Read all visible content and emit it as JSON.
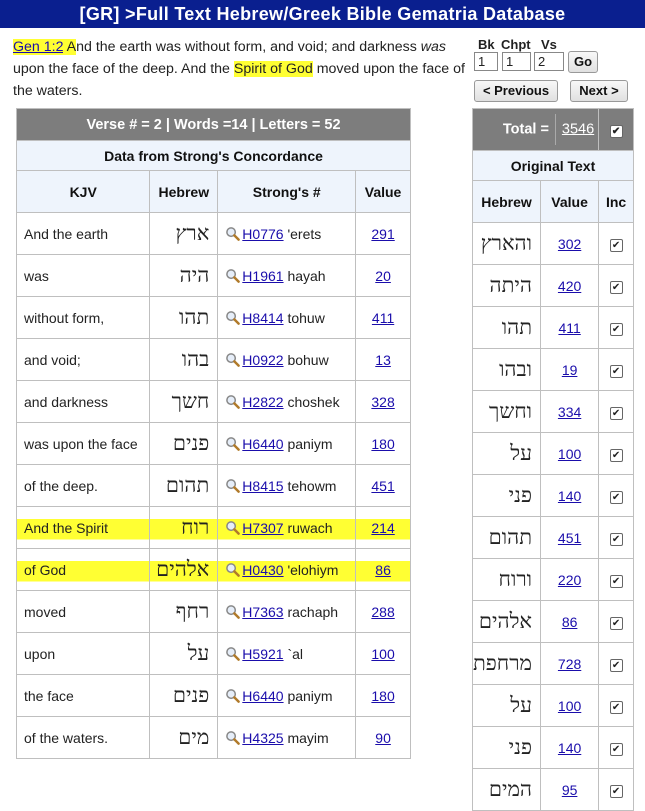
{
  "header": {
    "title": "[GR] >Full Text Hebrew/Greek Bible Gematria Database"
  },
  "verse": {
    "ref": "Gen 1:2",
    "seg_a": "A",
    "seg_b": "nd the earth was without form, and void; and darkness ",
    "seg_was": "was",
    "seg_c": " upon the face of the deep. And the ",
    "seg_spirit": "Spirit of God",
    "seg_d": " moved upon the face of the waters."
  },
  "nav": {
    "bk_label": "Bk",
    "chpt_label": "Chpt",
    "vs_label": "Vs",
    "bk": "1",
    "chpt": "1",
    "vs": "2",
    "go_label": "Go",
    "prev_label": "< Previous",
    "next_label": "Next >"
  },
  "main_table": {
    "summary": "Verse # = 2   |   Words =14   |   Letters = 52",
    "source": "Data from Strong's Concordance",
    "columns": [
      "KJV",
      "Hebrew",
      "Strong's #",
      "Value"
    ],
    "rows": [
      {
        "kjv": "And the earth",
        "heb": "ארץ",
        "code": "H0776",
        "word": "'erets",
        "value": "291"
      },
      {
        "kjv": "was",
        "heb": "היה",
        "code": "H1961",
        "word": "hayah",
        "value": "20"
      },
      {
        "kjv": "without form,",
        "heb": "תהו",
        "code": "H8414",
        "word": "tohuw",
        "value": "411"
      },
      {
        "kjv": "and void;",
        "heb": "בהו",
        "code": "H0922",
        "word": "bohuw",
        "value": "13"
      },
      {
        "kjv": "and darkness",
        "heb": "חשך",
        "code": "H2822",
        "word": "choshek",
        "value": "328"
      },
      {
        "kjv": "was upon the face",
        "heb": "פנים",
        "code": "H6440",
        "word": "paniym",
        "value": "180"
      },
      {
        "kjv": "of the deep.",
        "heb": "תהום",
        "code": "H8415",
        "word": "tehowm",
        "value": "451"
      },
      {
        "kjv": "And the Spirit",
        "heb": "רוח",
        "code": "H7307",
        "word": "ruwach",
        "value": "214"
      },
      {
        "kjv": "of God",
        "heb": "אלהים",
        "code": "H0430",
        "word": "'elohiym",
        "value": "86"
      },
      {
        "kjv": "moved",
        "heb": "רחף",
        "code": "H7363",
        "word": "rachaph",
        "value": "288"
      },
      {
        "kjv": "upon",
        "heb": "על",
        "code": "H5921",
        "word": "`al",
        "value": "100"
      },
      {
        "kjv": "the face",
        "heb": "פנים",
        "code": "H6440",
        "word": "paniym",
        "value": "180"
      },
      {
        "kjv": "of the waters.",
        "heb": "מים",
        "code": "H4325",
        "word": "mayim",
        "value": "90"
      }
    ]
  },
  "side_table": {
    "total_label": "Total =",
    "total_value": "3546",
    "title": "Original Text",
    "columns": [
      "Hebrew",
      "Value",
      "Inc"
    ],
    "rows": [
      {
        "heb": "והארץ",
        "value": "302"
      },
      {
        "heb": "היתה",
        "value": "420"
      },
      {
        "heb": "תהו",
        "value": "411"
      },
      {
        "heb": "ובהו",
        "value": "19"
      },
      {
        "heb": "וחשך",
        "value": "334"
      },
      {
        "heb": "על",
        "value": "100"
      },
      {
        "heb": "פני",
        "value": "140"
      },
      {
        "heb": "תהום",
        "value": "451"
      },
      {
        "heb": "ורוח",
        "value": "220"
      },
      {
        "heb": "אלהים",
        "value": "86"
      },
      {
        "heb": "מרחפת",
        "value": "728"
      },
      {
        "heb": "על",
        "value": "100"
      },
      {
        "heb": "פני",
        "value": "140"
      },
      {
        "heb": "המים",
        "value": "95"
      }
    ]
  },
  "colors": {
    "title_bar": "#0a1f8f",
    "summary_bar": "#7d7d7d",
    "subheader": "#eef4fc",
    "highlight": "#ffff33",
    "link": "#1a0dab"
  }
}
